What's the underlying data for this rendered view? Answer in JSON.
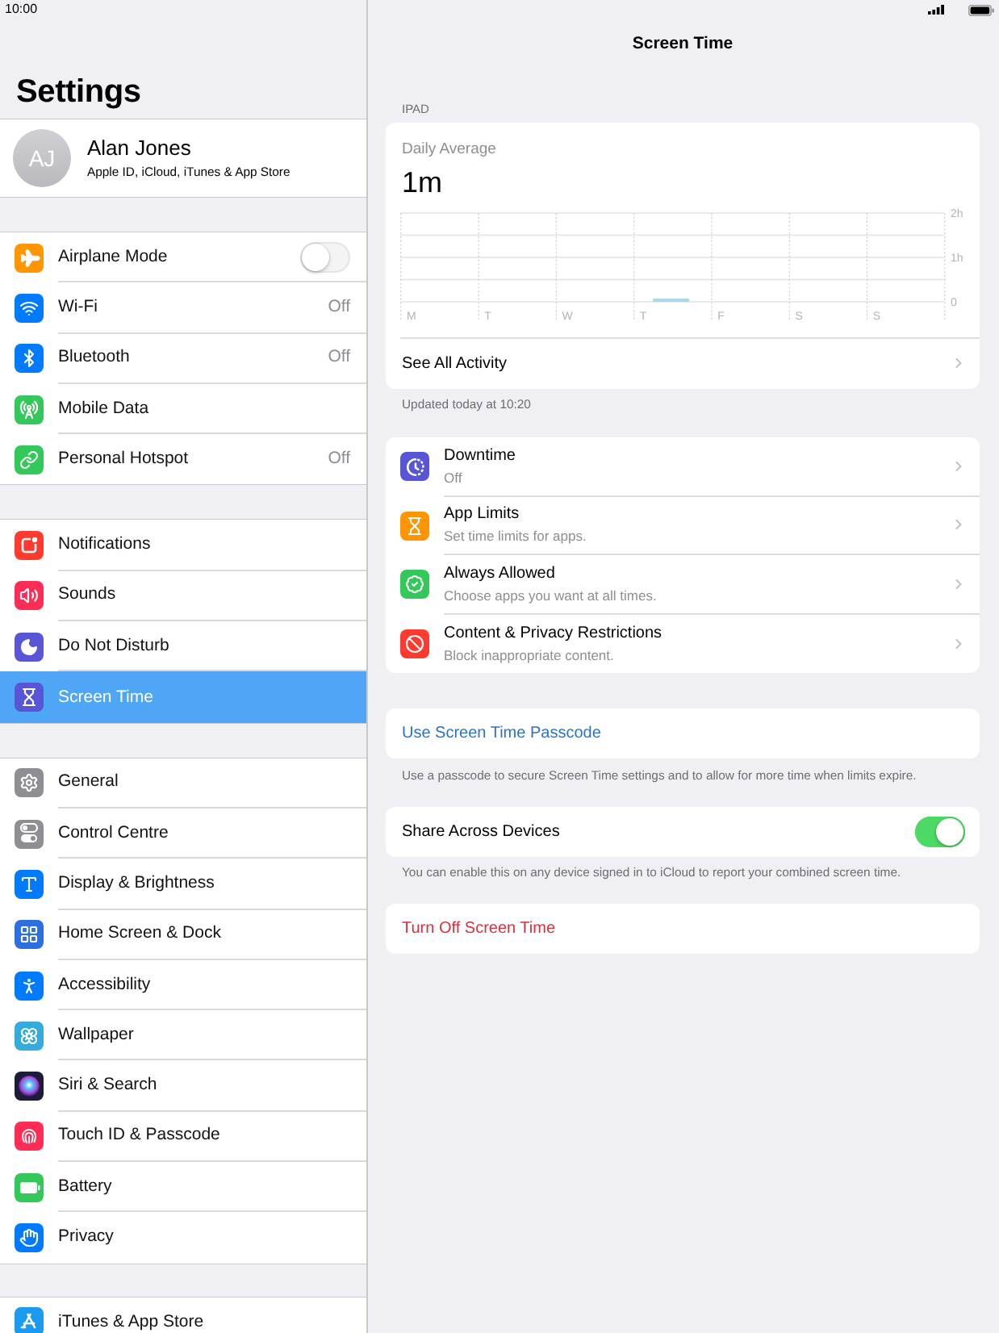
{
  "status_bar": {
    "time": "10:00"
  },
  "sidebar": {
    "title": "Settings",
    "profile": {
      "initials": "AJ",
      "name": "Alan Jones",
      "subtitle": "Apple ID, iCloud, iTunes & App Store"
    },
    "groups": [
      {
        "items": [
          {
            "label": "Airplane Mode",
            "on": false,
            "selected": false
          },
          {
            "label": "Wi-Fi",
            "value": "Off",
            "selected": false
          },
          {
            "label": "Bluetooth",
            "value": "Off",
            "selected": false
          },
          {
            "label": "Mobile Data",
            "selected": false
          },
          {
            "label": "Personal Hotspot",
            "value": "Off",
            "selected": false
          }
        ]
      },
      {
        "items": [
          {
            "label": "Notifications",
            "selected": false
          },
          {
            "label": "Sounds",
            "selected": false
          },
          {
            "label": "Do Not Disturb",
            "selected": false
          },
          {
            "label": "Screen Time",
            "selected": true
          }
        ]
      },
      {
        "items": [
          {
            "label": "General",
            "selected": false
          },
          {
            "label": "Control Centre",
            "selected": false
          },
          {
            "label": "Display & Brightness",
            "selected": false
          },
          {
            "label": "Home Screen & Dock",
            "selected": false
          },
          {
            "label": "Accessibility",
            "selected": false
          },
          {
            "label": "Wallpaper",
            "selected": false
          },
          {
            "label": "Siri & Search",
            "selected": false
          },
          {
            "label": "Touch ID & Passcode",
            "selected": false
          },
          {
            "label": "Battery",
            "selected": false
          },
          {
            "label": "Privacy",
            "selected": false
          }
        ]
      },
      {
        "items": [
          {
            "label": "iTunes & App Store",
            "selected": false
          }
        ]
      }
    ]
  },
  "detail": {
    "title": "Screen Time",
    "section_header": "IPAD",
    "usage": {
      "label": "Daily Average",
      "value": "1m",
      "chart_data": {
        "type": "bar",
        "categories": [
          "M",
          "T",
          "W",
          "T",
          "F",
          "S",
          "S"
        ],
        "values": [
          null,
          null,
          null,
          0.07,
          null,
          null,
          null
        ],
        "ylim": [
          0,
          2
        ],
        "yticks": [
          {
            "value": 0,
            "label": "0"
          },
          {
            "value": 1,
            "label": "1h"
          },
          {
            "value": 2,
            "label": "2h"
          }
        ]
      },
      "link": "See All Activity"
    },
    "updated_note": "Updated today at 10:20",
    "features": [
      {
        "title": "Downtime",
        "subtitle": "Off"
      },
      {
        "title": "App Limits",
        "subtitle": "Set time limits for apps."
      },
      {
        "title": "Always Allowed",
        "subtitle": "Choose apps you want at all times."
      },
      {
        "title": "Content & Privacy Restrictions",
        "subtitle": "Block inappropriate content."
      }
    ],
    "passcode": {
      "label": "Use Screen Time Passcode",
      "note": "Use a passcode to secure Screen Time settings and to allow for more time when limits expire."
    },
    "share": {
      "label": "Share Across Devices",
      "on": true,
      "note": "You can enable this on any device signed in to iCloud to report your combined screen time."
    },
    "turn_off": {
      "label": "Turn Off Screen Time"
    }
  }
}
